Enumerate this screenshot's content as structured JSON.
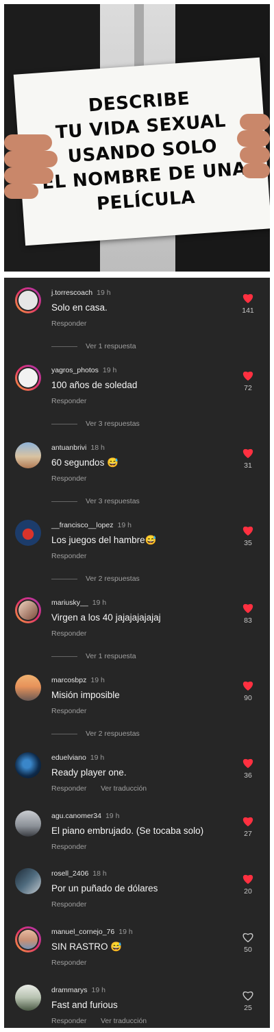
{
  "meme": {
    "sign_lines": [
      "DESCRIBE",
      "TU VIDA SEXUAL",
      "USANDO SOLO",
      "EL NOMBRE DE UNA",
      "PELÍCULA"
    ]
  },
  "colors": {
    "panel_bg": "#262626",
    "heart_liked": "#ff3040",
    "heart_outline": "#c8c8c8"
  },
  "comments": [
    {
      "username": "j.torrescoach",
      "time": "19 h",
      "text": "Solo en casa.",
      "reply": "Responder",
      "likes": "141",
      "liked": true,
      "replies": "Ver 1 respuesta"
    },
    {
      "username": "yagros_photos",
      "time": "19 h",
      "text": "100 años de soledad",
      "reply": "Responder",
      "likes": "72",
      "liked": true,
      "replies": "Ver 3 respuestas"
    },
    {
      "username": "antuanbrivi",
      "time": "18 h",
      "text": "60 segundos 😅",
      "reply": "Responder",
      "likes": "31",
      "liked": true,
      "replies": "Ver 3 respuestas"
    },
    {
      "username": "__francisco__lopez",
      "time": "19 h",
      "text": "Los juegos del hambre😅",
      "reply": "Responder",
      "likes": "35",
      "liked": true,
      "replies": "Ver 2 respuestas"
    },
    {
      "username": "mariusky__",
      "time": "19 h",
      "text": "Virgen a los 40 jajajajajajaj",
      "reply": "Responder",
      "likes": "83",
      "liked": true,
      "replies": "Ver 1 respuesta"
    },
    {
      "username": "marcosbpz",
      "time": "19 h",
      "text": "Misión imposible",
      "reply": "Responder",
      "likes": "90",
      "liked": true,
      "replies": "Ver 2 respuestas"
    },
    {
      "username": "eduelviano",
      "time": "19 h",
      "text": "Ready player one.",
      "reply": "Responder",
      "translate": "Ver traducción",
      "likes": "36",
      "liked": true
    },
    {
      "username": "agu.canomer34",
      "time": "19 h",
      "text": "El piano embrujado. (Se tocaba solo)",
      "reply": "Responder",
      "likes": "27",
      "liked": true
    },
    {
      "username": "rosell_2406",
      "time": "18 h",
      "text": "Por un puñado de dólares",
      "reply": "Responder",
      "likes": "20",
      "liked": true
    },
    {
      "username": "manuel_cornejo_76",
      "time": "19 h",
      "text": "SIN RASTRO 😅",
      "reply": "Responder",
      "likes": "50",
      "liked": false
    },
    {
      "username": "drammarys",
      "time": "19 h",
      "text": "Fast and furious",
      "reply": "Responder",
      "translate": "Ver traducción",
      "likes": "25",
      "liked": false
    }
  ]
}
